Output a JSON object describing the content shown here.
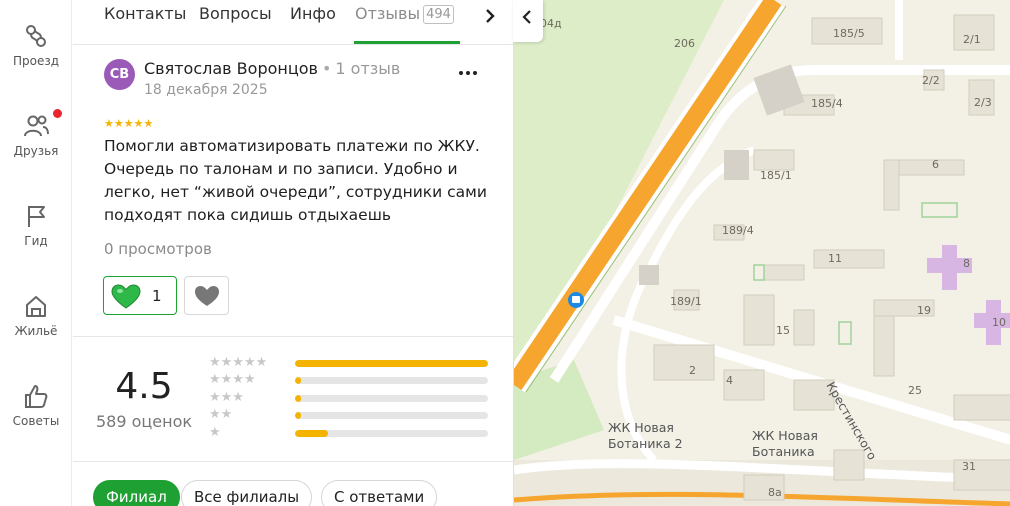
{
  "rail": {
    "items": [
      {
        "label": "Проезд",
        "icon": "route-icon"
      },
      {
        "label": "Друзья",
        "icon": "friends-icon"
      },
      {
        "label": "Гид",
        "icon": "flag-icon"
      },
      {
        "label": "Жильё",
        "icon": "home-hand-icon"
      },
      {
        "label": "Советы",
        "icon": "thumbs-up-icon"
      }
    ]
  },
  "tabs": {
    "items": [
      {
        "label": "Контакты"
      },
      {
        "label": "Вопросы"
      },
      {
        "label": "Инфо"
      },
      {
        "label": "Отзывы",
        "count": "494",
        "active": true
      }
    ]
  },
  "review": {
    "avatar_initials": "СВ",
    "author": "Святослав Воронцов",
    "author_reviews": "1 отзыв",
    "date": "18 декабря 2025",
    "stars": 5,
    "text": "Помогли автоматизировать платежи по ЖКУ. Очередь по талонам и по записи. Удобно и легко, нет “живой очереди”, сотрудники сами подходят пока сидишь отдыхаешь",
    "views": "0 просмотров",
    "likes": "1"
  },
  "rating": {
    "value": "4.5",
    "count_label": "589 оценок",
    "distribution": [
      {
        "stars": 5,
        "fraction": 1.0
      },
      {
        "stars": 4,
        "fraction": 0.03
      },
      {
        "stars": 3,
        "fraction": 0.03
      },
      {
        "stars": 2,
        "fraction": 0.03
      },
      {
        "stars": 1,
        "fraction": 0.17
      }
    ]
  },
  "filters": [
    {
      "label": "Филиал",
      "active": true
    },
    {
      "label": "Все филиалы",
      "active": false
    },
    {
      "label": "С ответами",
      "active": false
    }
  ],
  "map": {
    "labels": {
      "b185_5": "185/5",
      "b2_1": "2/1",
      "b2_2": "2/2",
      "b2_3": "2/3",
      "b206": "206",
      "b204d": "04д",
      "b185_4": "185/4",
      "b185_1": "185/1",
      "b6": "6",
      "b189_4": "189/4",
      "b11": "11",
      "b8": "8",
      "b189_1": "189/1",
      "b15": "15",
      "b19": "19",
      "b10": "10",
      "b2": "2",
      "b4": "4",
      "b25": "25",
      "street": "Крестинского",
      "zhk2_line1": "ЖК Новая",
      "zhk2_line2": "Ботаника 2",
      "zhk_line1": "ЖК Новая",
      "zhk_line2": "Ботаника",
      "b31": "31",
      "b8a": "8а"
    }
  },
  "colors": {
    "accent_green": "#1fa032",
    "star_yellow": "#f5b301",
    "avatar_purple": "#9b5ab8",
    "map_bg": "#f3f0e6",
    "road_orange": "#f6a52e"
  }
}
